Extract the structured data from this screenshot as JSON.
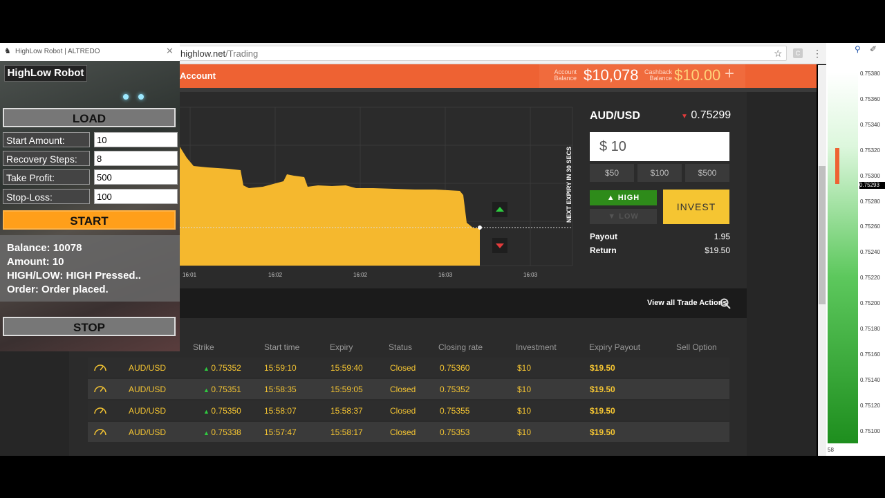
{
  "browser": {
    "url_host": "highlow.net",
    "url_path": "/Trading"
  },
  "header": {
    "account_link": "Account",
    "account_balance_label_1": "Account",
    "account_balance_label_2": "Balance",
    "account_balance": "$10,078",
    "cashback_label_1": "Cashback",
    "cashback_label_2": "Balance",
    "cashback_balance": "$10.00",
    "plus": "+"
  },
  "chart": {
    "expiry_label": "NEXT EXPIRY IN 30 SECS",
    "time_ticks": [
      "16:01",
      "16:02",
      "16:02",
      "16:03",
      "16:03"
    ]
  },
  "trade": {
    "pair": "AUD/USD",
    "rate": "0.75299",
    "amount": "$ 10",
    "quick_amounts": [
      "$50",
      "$100",
      "$500"
    ],
    "high_label": "HIGH",
    "low_label": "LOW",
    "invest_label": "INVEST",
    "payout_label": "Payout",
    "payout_value": "1.95",
    "return_label": "Return",
    "return_value": "$19.50"
  },
  "actions": {
    "view_all": "View all Trade Actions"
  },
  "table": {
    "headers": [
      "Strike",
      "Start time",
      "Expiry",
      "Status",
      "Closing rate",
      "Investment",
      "Expiry Payout",
      "Sell Option"
    ],
    "rows": [
      {
        "asset": "AUD/USD",
        "strike": "0.75352",
        "start": "15:59:10",
        "expiry": "15:59:40",
        "status": "Closed",
        "closing": "0.75360",
        "investment": "$10",
        "payout": "$19.50"
      },
      {
        "asset": "AUD/USD",
        "strike": "0.75351",
        "start": "15:58:35",
        "expiry": "15:59:05",
        "status": "Closed",
        "closing": "0.75352",
        "investment": "$10",
        "payout": "$19.50"
      },
      {
        "asset": "AUD/USD",
        "strike": "0.75350",
        "start": "15:58:07",
        "expiry": "15:58:37",
        "status": "Closed",
        "closing": "0.75355",
        "investment": "$10",
        "payout": "$19.50"
      },
      {
        "asset": "AUD/USD",
        "strike": "0.75338",
        "start": "15:57:47",
        "expiry": "15:58:17",
        "status": "Closed",
        "closing": "0.75353",
        "investment": "$10",
        "payout": "$19.50"
      }
    ]
  },
  "robot": {
    "title": "HighLow Robot | ALTREDO",
    "logo": "HighLow Robot",
    "load": "LOAD",
    "start_amount_label": "Start Amount:",
    "start_amount": "10",
    "recovery_label": "Recovery Steps:",
    "recovery": "8",
    "take_profit_label": "Take Profit:",
    "take_profit": "500",
    "stop_loss_label": "Stop-Loss:",
    "stop_loss": "100",
    "start": "START",
    "status_balance": "Balance: 10078",
    "status_amount": "Amount: 10",
    "status_highlow": "HIGH/LOW: HIGH Pressed..",
    "status_order": "Order: Order placed.",
    "stop": "STOP"
  },
  "mt4": {
    "ticks": [
      "0.75380",
      "0.75360",
      "0.75340",
      "0.75320",
      "0.75300",
      "0.75280",
      "0.75260",
      "0.75240",
      "0.75220",
      "0.75200",
      "0.75180",
      "0.75160",
      "0.75140",
      "0.75120",
      "0.75100"
    ],
    "current": "0.75293",
    "bottom_label": "58"
  },
  "colors": {
    "accent": "#ee6233",
    "gold": "#f5c532",
    "high_green": "#2e8b1a",
    "down_red": "#e23b3b"
  }
}
